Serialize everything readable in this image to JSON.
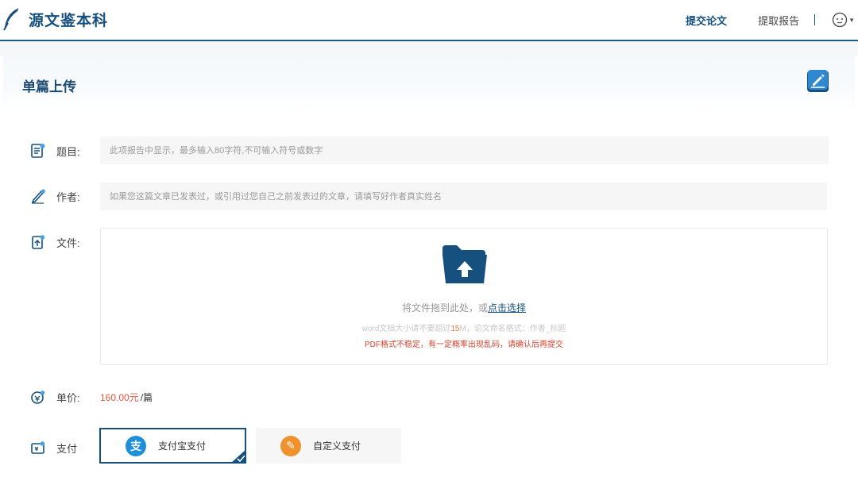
{
  "header": {
    "logo_text": "源文鉴本科",
    "nav_submit": "提交论文",
    "nav_report": "提取报告",
    "nav_separator": "|",
    "accent_color": "#16507f"
  },
  "page": {
    "title": "单篇上传"
  },
  "form": {
    "title_label": "题目:",
    "title_placeholder": "此项报告中显示，最多输入80字符,不可输入符号或数字",
    "author_label": "作者:",
    "author_placeholder": "如果您这篇文章已发表过，或引用过您自己之前发表过的文章，请填写好作者真实姓名",
    "file_label": "文件:",
    "dropzone": {
      "main_text": "将文件拖到此处，或",
      "link_text": "点击选择",
      "hint_prefix": "word文档大小请不要超过",
      "hint_highlight": "15",
      "hint_suffix": "M，论文命名格式：作者_标题",
      "warning": "PDF格式不稳定，有一定概率出现乱码，请确认后再提交"
    },
    "price_label": "单价:",
    "price_value": "160.00元",
    "price_unit": "/篇",
    "pay_label": "支付",
    "pay_options": [
      {
        "label": "支付宝支付",
        "icon_glyph": "支",
        "selected": true
      },
      {
        "label": "自定义支付",
        "icon_glyph": "✎",
        "selected": false
      }
    ]
  }
}
